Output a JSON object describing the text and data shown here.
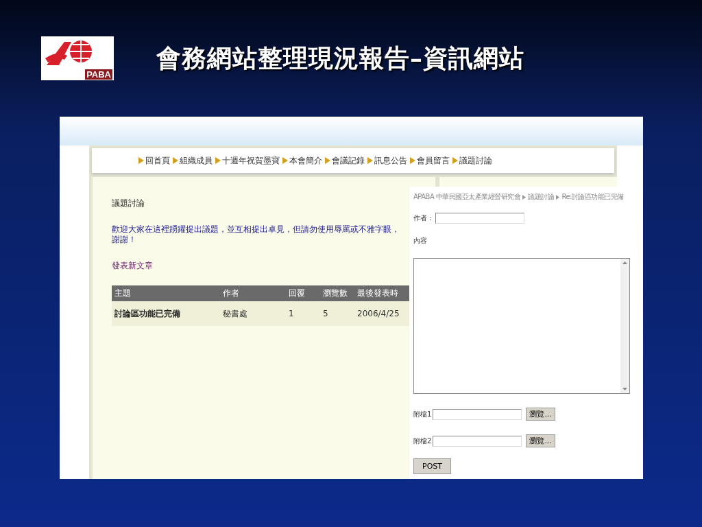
{
  "slide": {
    "title": "會務網站整理現況報告–資訊網站",
    "logo_text": "PABA"
  },
  "nav": [
    "回首頁",
    "組織成員",
    "十週年祝賀墨寶",
    "本會簡介",
    "會議記錄",
    "訊息公告",
    "會員留言",
    "議題討論"
  ],
  "forum": {
    "heading": "議題討論",
    "intro": "歡迎大家在這裡踴躍提出議題，並互相提出卓見，但請勿使用辱罵或不雅字眼，謝謝！",
    "new_post_link": "發表新文章",
    "columns": [
      "主題",
      "作者",
      "回覆",
      "瀏覽數",
      "最後發表時"
    ],
    "rows": [
      [
        "討論區功能已完備",
        "秘書處",
        "1",
        "5",
        "2006/4/25"
      ]
    ]
  },
  "form": {
    "breadcrumb": [
      "APABA 中華民國亞太產業經營研究會",
      "議題討論",
      "Re:討論區功能已完備"
    ],
    "author_label": "作者：",
    "content_label": "內容",
    "attachments": [
      {
        "label": "附檔1",
        "button": "瀏覽..."
      },
      {
        "label": "附檔2",
        "button": "瀏覽..."
      }
    ],
    "submit": "POST"
  }
}
